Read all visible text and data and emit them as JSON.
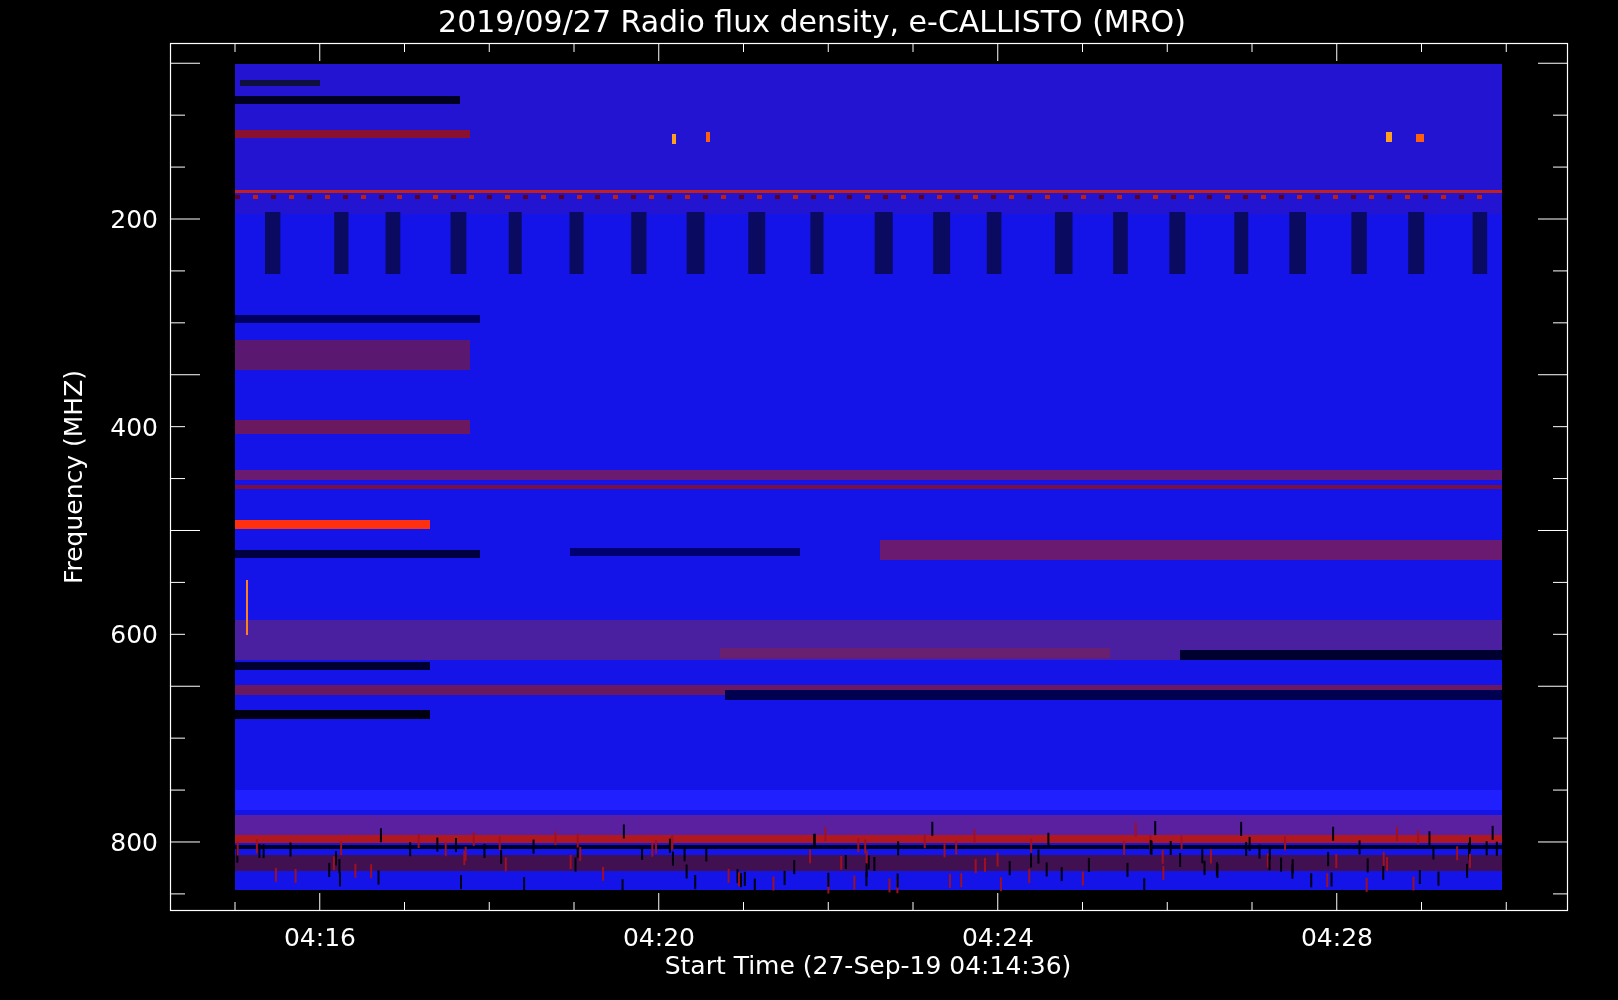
{
  "title": "2019/09/27  Radio flux density, e-CALLISTO (MRO)",
  "y_axis": {
    "label": "Frequency (MHZ)",
    "tick_labels": [
      "200",
      "400",
      "600",
      "800"
    ]
  },
  "x_axis": {
    "label": "Start Time (27-Sep-19 04:14:36)",
    "tick_labels": [
      "04:16",
      "04:20",
      "04:24",
      "04:28"
    ]
  }
}
